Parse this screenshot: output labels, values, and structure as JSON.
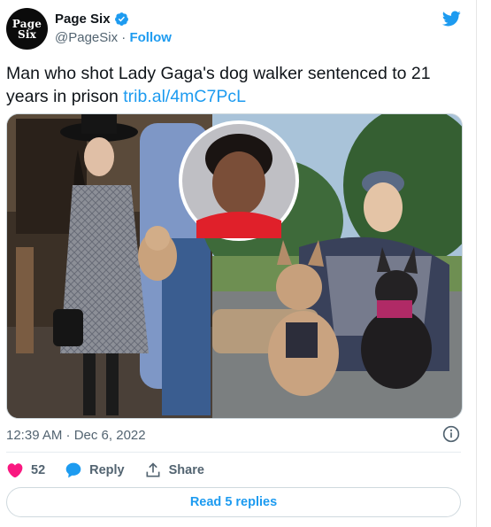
{
  "account": {
    "avatar_text_line1": "Page",
    "avatar_text_line2": "Six",
    "name": "Page Six",
    "handle": "@PageSix",
    "separator": "·",
    "follow_label": "Follow"
  },
  "tweet": {
    "text": "Man who shot Lady Gaga's dog walker sentenced to 21 years in prison ",
    "link": "trib.al/4mC7PcL",
    "timestamp": "12:39 AM · Dec 6, 2022"
  },
  "actions": {
    "like_count": "52",
    "reply_label": "Reply",
    "share_label": "Share",
    "read_replies_label": "Read 5 replies"
  },
  "colors": {
    "accent": "#1d9bf0",
    "like": "#f91880"
  },
  "icons": [
    "verified-badge-icon",
    "twitter-bird-icon",
    "info-icon",
    "heart-icon",
    "reply-bubble-icon",
    "share-icon"
  ]
}
